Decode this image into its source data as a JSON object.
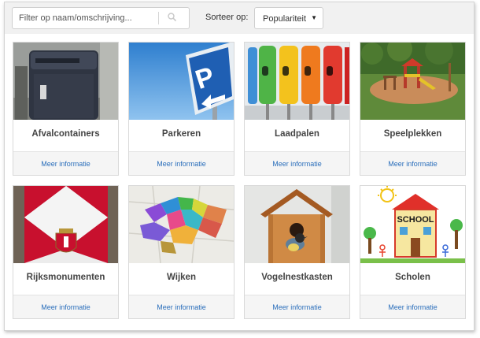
{
  "search": {
    "placeholder": "Filter op naam/omschrijving..."
  },
  "sort": {
    "label": "Sorteer op:",
    "selected": "Populariteit"
  },
  "icons": {
    "search": "search-icon",
    "caret": "caret-down-icon"
  },
  "colors": {
    "link": "#2a6ebb",
    "title": "#444444"
  },
  "cards": [
    {
      "title": "Afvalcontainers",
      "link": "Meer informatie"
    },
    {
      "title": "Parkeren",
      "link": "Meer informatie"
    },
    {
      "title": "Laadpalen",
      "link": "Meer informatie"
    },
    {
      "title": "Speelplekken",
      "link": "Meer informatie"
    },
    {
      "title": "Rijksmonumenten",
      "link": "Meer informatie"
    },
    {
      "title": "Wijken",
      "link": "Meer informatie"
    },
    {
      "title": "Vogelnestkasten",
      "link": "Meer informatie"
    },
    {
      "title": "Scholen",
      "link": "Meer informatie"
    }
  ],
  "images": {
    "scholen_sign": "SCHOOL"
  }
}
